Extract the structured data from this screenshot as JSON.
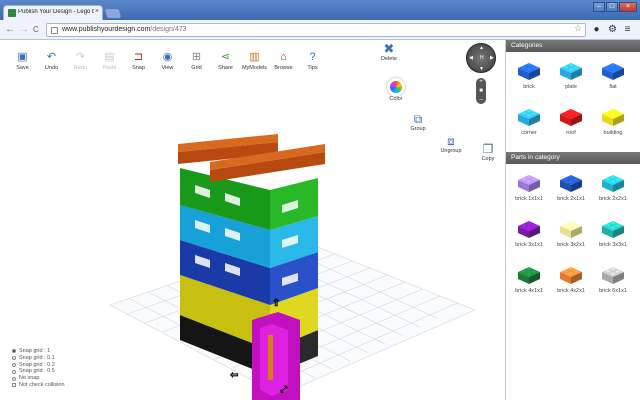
{
  "browser": {
    "tab_title": "Publish Your Design - Lego bu",
    "tab_close": "×",
    "url_host": "www.publishyourdesign.com",
    "url_path": "/design/473",
    "nav_back": "←",
    "nav_forward": "→",
    "nav_reload": "C",
    "star": "☆",
    "min": "–",
    "max": "□",
    "close": "×"
  },
  "tools": [
    {
      "label": "Save",
      "icon": "▣",
      "enabled": true
    },
    {
      "label": "Undo",
      "icon": "↶",
      "enabled": true
    },
    {
      "label": "Redo",
      "icon": "↷",
      "enabled": false
    },
    {
      "label": "Paste",
      "icon": "▤",
      "enabled": false
    },
    {
      "label": "Snap",
      "icon": "⊐",
      "enabled": true
    },
    {
      "label": "View",
      "icon": "◉",
      "enabled": true
    },
    {
      "label": "Grid",
      "icon": "⊞",
      "enabled": true
    },
    {
      "label": "Share",
      "icon": "⋖",
      "enabled": true
    },
    {
      "label": "MyModels",
      "icon": "▥",
      "enabled": true
    },
    {
      "label": "Browse",
      "icon": "⌂",
      "enabled": true
    },
    {
      "label": "Tips",
      "icon": "?",
      "enabled": true
    }
  ],
  "actions": {
    "delete": "Delete",
    "color": "Color",
    "group": "Group",
    "ungroup": "Ungroup",
    "copy": "Copy",
    "zoom_plus": "+",
    "zoom_minus": "–",
    "nav_h": "H"
  },
  "snap_options": [
    {
      "label": "Snap grid : 1",
      "selected": true
    },
    {
      "label": "Snap grid : 0.1",
      "selected": false
    },
    {
      "label": "Snap grid : 0.2",
      "selected": false
    },
    {
      "label": "Snap grid : 0.5",
      "selected": false
    },
    {
      "label": "No snap",
      "selected": false
    }
  ],
  "collision_label": "Not check collision",
  "categories_header": "Categories",
  "categories": [
    {
      "label": "brick",
      "color": "#1f5fc8"
    },
    {
      "label": "plate",
      "color": "#2aa8e0"
    },
    {
      "label": "flat",
      "color": "#1f5fc8"
    },
    {
      "label": "corner",
      "color": "#2aa8e0"
    },
    {
      "label": "roof",
      "color": "#d01818"
    },
    {
      "label": "building",
      "color": "#e8d818"
    }
  ],
  "parts_header": "Parts in category",
  "parts": [
    {
      "label": "brick 1x1x1",
      "color": "#9a7ad8"
    },
    {
      "label": "brick 2x1x1",
      "color": "#1f4fb0"
    },
    {
      "label": "brick 2x2x1",
      "color": "#20b0c8"
    },
    {
      "label": "brick 3x1x1",
      "color": "#7a1aa8"
    },
    {
      "label": "brick 3x2x1",
      "color": "#e8e090"
    },
    {
      "label": "brick 3x3x1",
      "color": "#20b0a8"
    },
    {
      "label": "brick 4x1x1",
      "color": "#1a7a3a"
    },
    {
      "label": "brick 4x2x1",
      "color": "#e07a30"
    },
    {
      "label": "brick 6x1x1",
      "color": "#a8a8a8"
    }
  ]
}
